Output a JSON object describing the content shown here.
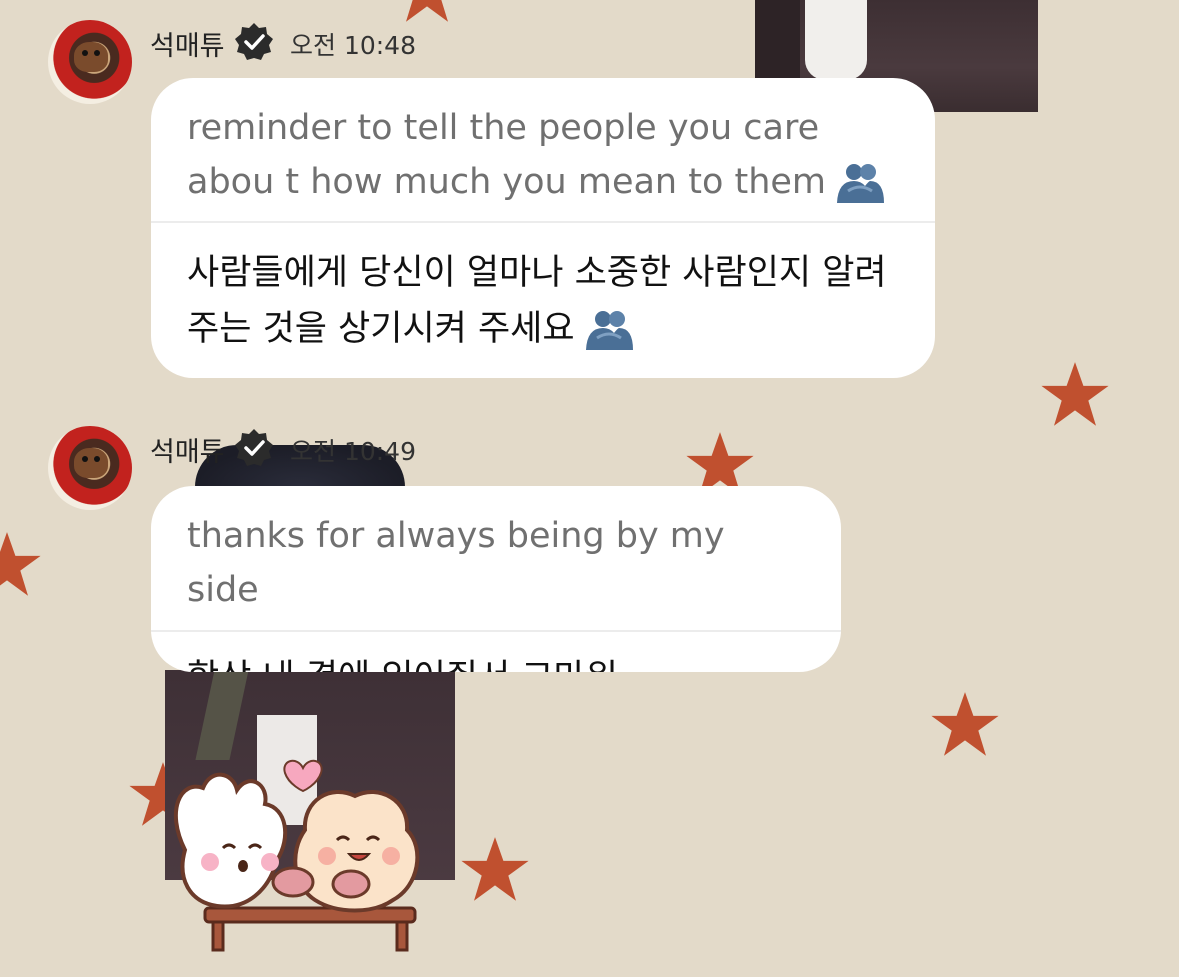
{
  "messages": [
    {
      "sender": "석매튜",
      "time": "오전 10:48",
      "text_en": "reminder to tell the people you care abou t how much you mean to them",
      "text_ko": "사람들에게 당신이 얼마나 소중한 사람인지 알려주는 것을 상기시켜 주세요",
      "emoji": "hugging-people-icon"
    },
    {
      "sender": "석매튜",
      "time": "오전 10:49",
      "text_en": "thanks for always being by my side",
      "text_ko": "항상 내 곁에 있어줘서 고마워"
    }
  ],
  "icons": {
    "verified_badge": "verified-badge-icon",
    "emoji": "hugging-people-icon",
    "sticker": "bunny-and-bear-sticker"
  },
  "colors": {
    "background": "#e3dac9",
    "star": "#c0502f",
    "bubble": "#ffffff",
    "english_text": "#707070",
    "korean_text": "#111111",
    "badge": "#2b2b2b",
    "emoji": "#4a6f96"
  }
}
